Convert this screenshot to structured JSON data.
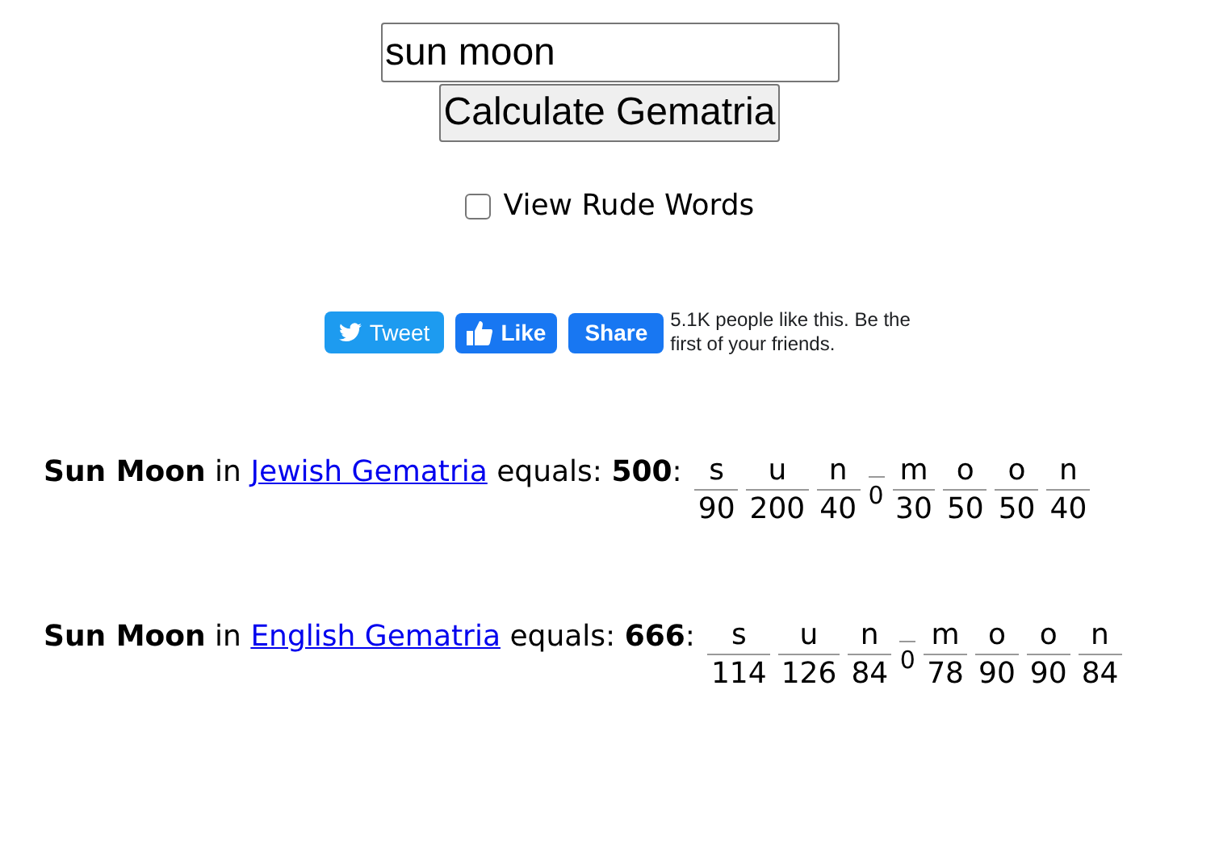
{
  "search": {
    "value": "sun moon"
  },
  "calculate_button": "Calculate Gematria",
  "rude_words": {
    "label": "View Rude Words",
    "checked": false
  },
  "social": {
    "tweet": "Tweet",
    "like": "Like",
    "share": "Share",
    "like_text": "5.1K people like this. Be the first of your friends."
  },
  "results": [
    {
      "before": "**Sun Moon** in",
      "link": "Jewish Gematria",
      "after": "equals: **500**:",
      "letters": [
        {
          "kind": "letter",
          "letter": "s",
          "value": "90"
        },
        {
          "kind": "letter",
          "letter": "u",
          "value": "200"
        },
        {
          "kind": "letter",
          "letter": "n",
          "value": "40"
        },
        {
          "kind": "space",
          "value": "0"
        },
        {
          "kind": "letter",
          "letter": "m",
          "value": "30"
        },
        {
          "kind": "letter",
          "letter": "o",
          "value": "50"
        },
        {
          "kind": "letter",
          "letter": "o",
          "value": "50"
        },
        {
          "kind": "letter",
          "letter": "n",
          "value": "40"
        }
      ]
    },
    {
      "before": "**Sun Moon** in",
      "link": "English Gematria",
      "after": "equals: **666**:",
      "letters": [
        {
          "kind": "letter",
          "letter": "s",
          "value": "114"
        },
        {
          "kind": "letter",
          "letter": "u",
          "value": "126"
        },
        {
          "kind": "letter",
          "letter": "n",
          "value": "84"
        },
        {
          "kind": "space",
          "value": "0"
        },
        {
          "kind": "letter",
          "letter": "m",
          "value": "78"
        },
        {
          "kind": "letter",
          "letter": "o",
          "value": "90"
        },
        {
          "kind": "letter",
          "letter": "o",
          "value": "90"
        },
        {
          "kind": "letter",
          "letter": "n",
          "value": "84"
        }
      ]
    }
  ]
}
